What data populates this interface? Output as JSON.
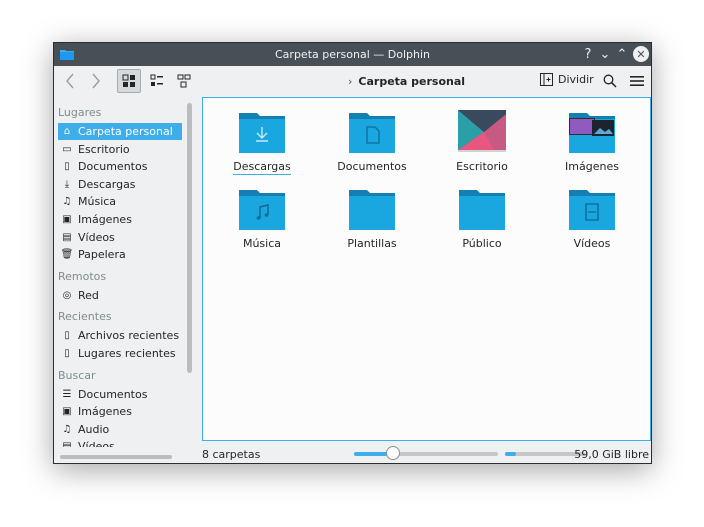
{
  "window": {
    "title": "Carpeta personal — Dolphin",
    "help": "?",
    "minimize": "⌄",
    "maximize": "⌃",
    "close": "✕"
  },
  "toolbar": {
    "breadcrumb_chevron": "›",
    "breadcrumb": "Carpeta personal",
    "split_label": "Dividir",
    "active_view": "icons"
  },
  "sidebar": {
    "sections": [
      {
        "title": "Lugares",
        "items": [
          {
            "label": "Carpeta personal",
            "icon": "home-icon",
            "glyph": "⌂",
            "active": true
          },
          {
            "label": "Escritorio",
            "icon": "desktop-icon",
            "glyph": "▭"
          },
          {
            "label": "Documentos",
            "icon": "documents-icon",
            "glyph": "▯"
          },
          {
            "label": "Descargas",
            "icon": "download-icon",
            "glyph": "⤓"
          },
          {
            "label": "Música",
            "icon": "music-icon",
            "glyph": "♫"
          },
          {
            "label": "Imágenes",
            "icon": "image-icon",
            "glyph": "▣"
          },
          {
            "label": "Vídeos",
            "icon": "film-icon",
            "glyph": "▤"
          },
          {
            "label": "Papelera",
            "icon": "trash-icon",
            "glyph": "🗑"
          }
        ]
      },
      {
        "title": "Remotos",
        "items": [
          {
            "label": "Red",
            "icon": "network-icon",
            "glyph": "◎"
          }
        ]
      },
      {
        "title": "Recientes",
        "items": [
          {
            "label": "Archivos recientes",
            "icon": "recent-files-icon",
            "glyph": "▯"
          },
          {
            "label": "Lugares recientes",
            "icon": "recent-places-icon",
            "glyph": "▯"
          }
        ]
      },
      {
        "title": "Buscar",
        "items": [
          {
            "label": "Documentos",
            "icon": "text-icon",
            "glyph": "☰"
          },
          {
            "label": "Imágenes",
            "icon": "image-icon",
            "glyph": "▣"
          },
          {
            "label": "Audio",
            "icon": "music-icon",
            "glyph": "♫"
          },
          {
            "label": "Vídeos",
            "icon": "film-icon",
            "glyph": "▤"
          }
        ]
      }
    ]
  },
  "files": [
    {
      "label": "Descargas",
      "type": "folder",
      "emblem": "download",
      "focused": true
    },
    {
      "label": "Documentos",
      "type": "folder",
      "emblem": "document"
    },
    {
      "label": "Escritorio",
      "type": "wallpaper"
    },
    {
      "label": "Imágenes",
      "type": "folder",
      "emblem": "pictures"
    },
    {
      "label": "Música",
      "type": "folder",
      "emblem": "music"
    },
    {
      "label": "Plantillas",
      "type": "folder",
      "emblem": "none"
    },
    {
      "label": "Público",
      "type": "folder",
      "emblem": "none"
    },
    {
      "label": "Vídeos",
      "type": "folder",
      "emblem": "video"
    }
  ],
  "status": {
    "count_text": "8 carpetas",
    "zoom_fraction": 0.27,
    "free_space_text": "59,0 GiB libre",
    "used_fraction": 0.14
  },
  "colors": {
    "accent": "#3daee9",
    "folder": "#1aa7e0",
    "folder_dark": "#147fb0",
    "titlebar": "#475057"
  }
}
